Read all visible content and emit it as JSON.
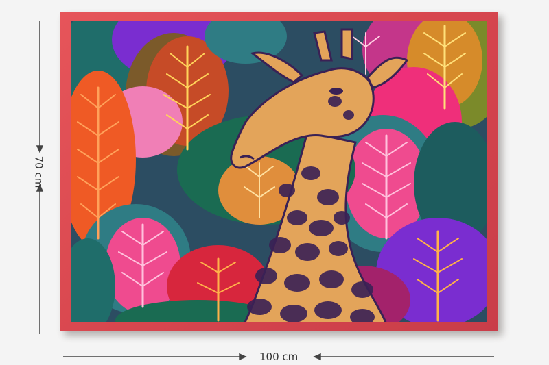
{
  "product": {
    "height_label": "70 cm",
    "width_label": "100 cm"
  },
  "colors": {
    "frame": "#d8474f",
    "giraffe_body": "#e3a45a",
    "giraffe_spots": "#3a2155",
    "teal_leaf": "#2f7c84",
    "pink_leaf": "#ef4b8f",
    "orange_leaf": "#f26a25",
    "violet_leaf": "#7a2dd0",
    "olive_leaf": "#7b8a2a",
    "background": "#f4f4f4"
  }
}
